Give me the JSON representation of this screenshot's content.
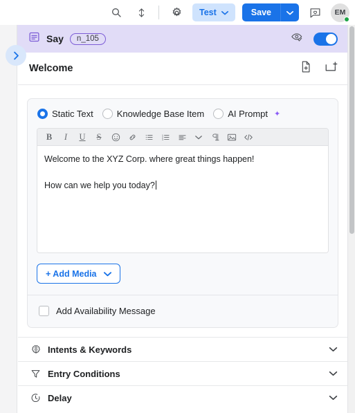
{
  "topbar": {
    "icons": [
      {
        "name": "search-icon",
        "label": "Search"
      },
      {
        "name": "sort-icon",
        "label": "Sort"
      },
      {
        "name": "gear-icon",
        "label": "Settings"
      }
    ],
    "test_label": "Test",
    "save_label": "Save",
    "chat_icon": "chat-heart-icon",
    "avatar_initials": "EM",
    "status": "online",
    "accent_blue": "#1a73e8",
    "test_bg": "#cfe3fd",
    "status_green": "#1ea446"
  },
  "node": {
    "icon": "say-node-icon",
    "title": "Say",
    "badge": "n_105",
    "preview_icon": "eye-check-icon",
    "enabled": true,
    "header_bg": "#e1dcf7",
    "badge_border": "#7c5cd6"
  },
  "welcome": {
    "title": "Welcome",
    "icons": [
      {
        "name": "duplicate-document-icon"
      },
      {
        "name": "add-panel-icon"
      }
    ]
  },
  "content_type": {
    "options": [
      {
        "label": "Static Text",
        "selected": true,
        "sparkle": false
      },
      {
        "label": "Knowledge Base Item",
        "selected": false,
        "sparkle": false
      },
      {
        "label": "AI Prompt",
        "selected": false,
        "sparkle": true
      }
    ],
    "sparkle_color": "#8b5cf6"
  },
  "editor": {
    "toolbar": [
      {
        "name": "bold-icon",
        "glyph": "B"
      },
      {
        "name": "italic-icon",
        "glyph": "I"
      },
      {
        "name": "underline-icon",
        "glyph": "U"
      },
      {
        "name": "strikethrough-icon",
        "glyph": "S"
      },
      {
        "name": "emoji-icon",
        "glyph": ""
      },
      {
        "name": "link-icon",
        "glyph": ""
      },
      {
        "name": "bulleted-list-icon",
        "glyph": ""
      },
      {
        "name": "numbered-list-icon",
        "glyph": ""
      },
      {
        "name": "align-icon",
        "glyph": ""
      },
      {
        "name": "chevron-down-icon",
        "glyph": ""
      },
      {
        "name": "text-direction-icon",
        "glyph": ""
      },
      {
        "name": "image-icon",
        "glyph": ""
      },
      {
        "name": "code-icon",
        "glyph": ""
      }
    ],
    "paragraphs": [
      "Welcome to the XYZ Corp. where great things happen!",
      "How can we help you today?"
    ]
  },
  "media": {
    "add_media_label": "+ Add Media",
    "caret_icon": "chevron-down-icon"
  },
  "availability": {
    "label": "Add Availability Message",
    "checked": false
  },
  "accordion": [
    {
      "label": "Intents & Keywords",
      "icon": "brain-icon",
      "expanded": false
    },
    {
      "label": "Entry Conditions",
      "icon": "funnel-icon",
      "expanded": false
    },
    {
      "label": "Delay",
      "icon": "clock-icon",
      "expanded": false
    }
  ],
  "sidebar": {
    "collapse_icon": "chevron-right-icon"
  }
}
